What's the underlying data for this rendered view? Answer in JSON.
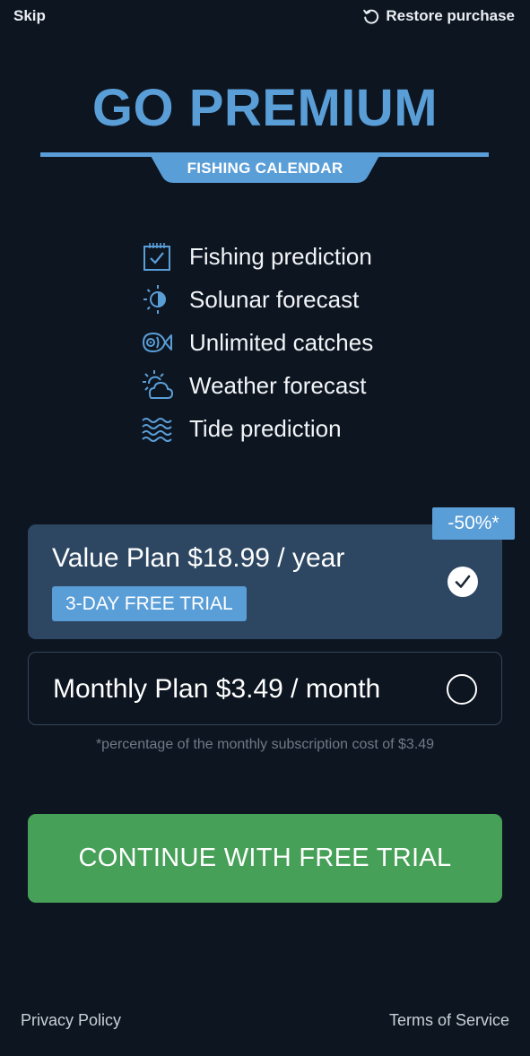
{
  "header": {
    "skip_label": "Skip",
    "restore_label": "Restore purchase",
    "restore_icon": "restore-icon"
  },
  "hero": {
    "title": "GO PREMIUM",
    "subtitle": "FISHING CALENDAR"
  },
  "features": [
    {
      "label": "Fishing prediction",
      "icon": "calendar-check-icon"
    },
    {
      "label": "Solunar forecast",
      "icon": "moon-phase-icon"
    },
    {
      "label": "Unlimited catches",
      "icon": "fish-icon"
    },
    {
      "label": "Weather forecast",
      "icon": "sun-cloud-icon"
    },
    {
      "label": "Tide prediction",
      "icon": "waves-icon"
    }
  ],
  "plans": {
    "discount_badge": "-50%*",
    "value": {
      "title": "Value Plan $18.99 / year",
      "badge": "3-DAY FREE TRIAL",
      "selected": true
    },
    "monthly": {
      "title": "Monthly Plan $3.49 / month",
      "selected": false
    },
    "footnote": "*percentage of the monthly subscription cost of $3.49"
  },
  "cta": {
    "label": "CONTINUE WITH FREE TRIAL"
  },
  "footer": {
    "privacy_label": "Privacy Policy",
    "terms_label": "Terms of Service"
  },
  "colors": {
    "background": "#0d1520",
    "accent_blue": "#5a9ed8",
    "selected_plan": "#2d4763",
    "cta_green": "#47a058"
  }
}
